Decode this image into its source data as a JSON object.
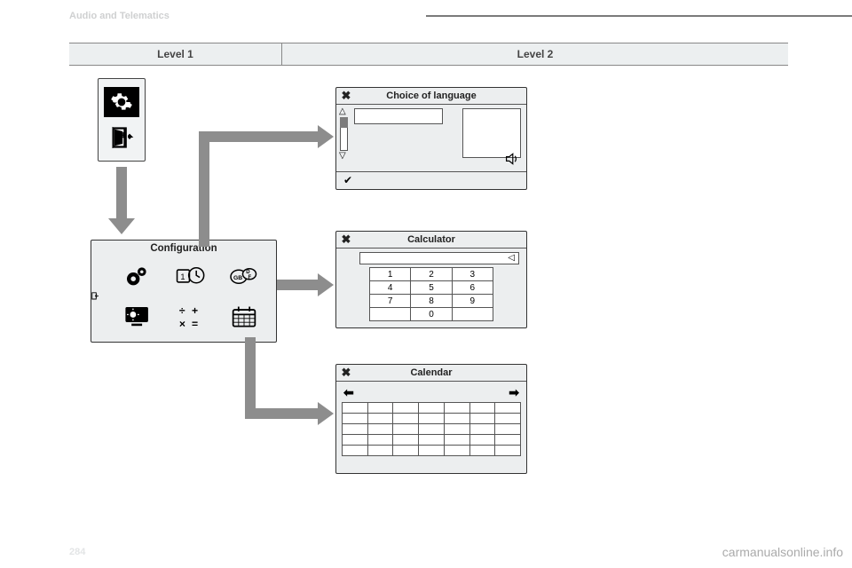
{
  "header": {
    "section": "Audio and Telematics"
  },
  "page_number": "284",
  "watermark": "carmanualsonline.info",
  "levels": {
    "l1": "Level 1",
    "l2": "Level 2"
  },
  "config": {
    "title": "Configuration"
  },
  "panels": {
    "language": {
      "title": "Choice of language",
      "close": "✖",
      "confirm": "✔"
    },
    "calculator": {
      "title": "Calculator",
      "close": "✖",
      "backspace": "◁",
      "keys": {
        "k1": "1",
        "k2": "2",
        "k3": "3",
        "k4": "4",
        "k5": "5",
        "k6": "6",
        "k7": "7",
        "k8": "8",
        "k9": "9",
        "k0": "0"
      }
    },
    "calendar": {
      "title": "Calendar",
      "close": "✖",
      "prev": "⬅",
      "next": "➡"
    }
  }
}
